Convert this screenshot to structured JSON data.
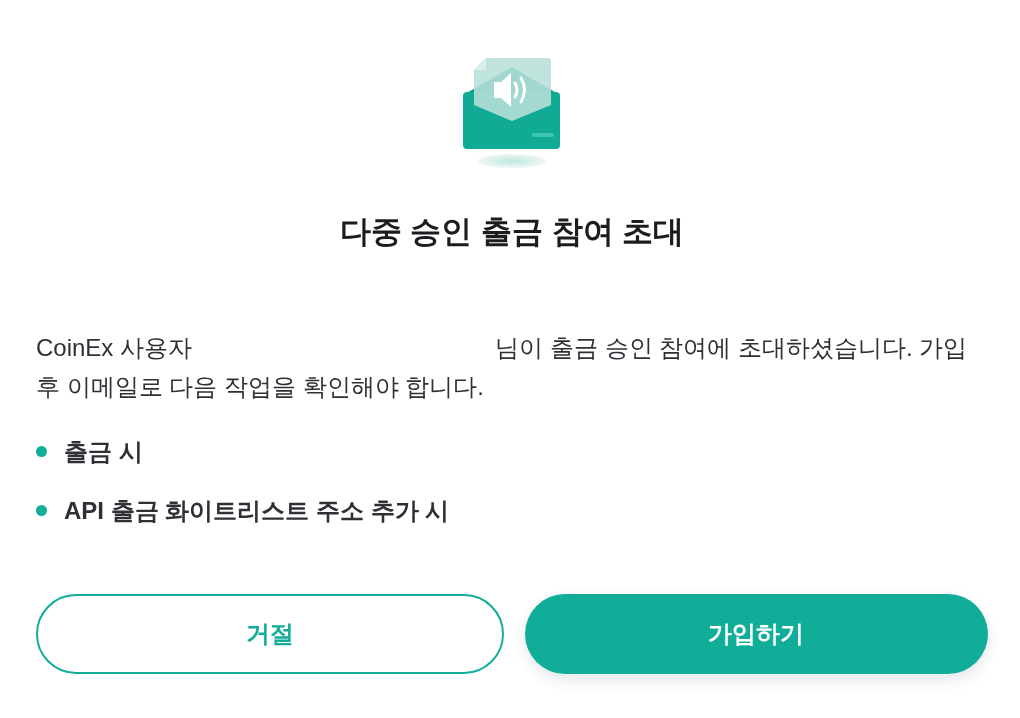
{
  "dialog": {
    "title": "다중 승인 출금 참여 초대",
    "message": {
      "before": "CoinEx 사용자",
      "after": "님이 출금 승인 참여에 초대하셨습니다. 가입 후 이메일로 다음 작업을 확인해야 합니다."
    },
    "actions": [
      "출금 시",
      "API 출금 화이트리스트 주소 추가 시"
    ],
    "buttons": [
      {
        "kind": "secondary",
        "label": "거절"
      },
      {
        "kind": "primary",
        "label": "가입하기"
      }
    ]
  }
}
